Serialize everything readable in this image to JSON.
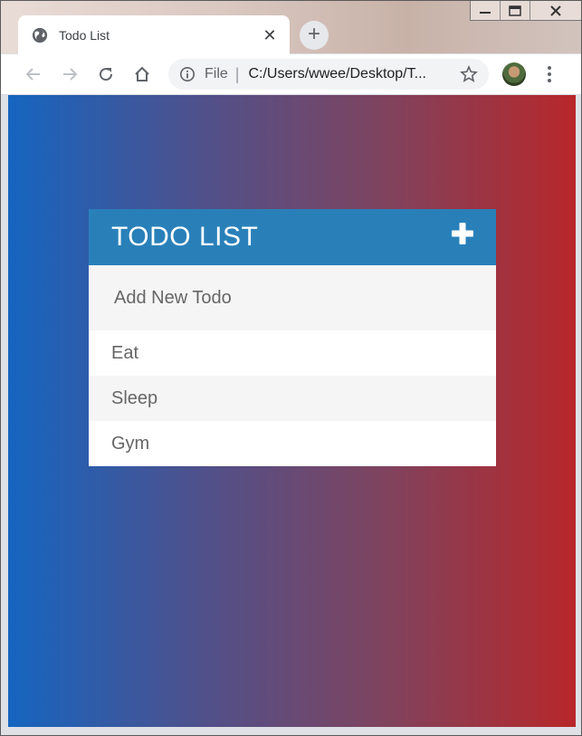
{
  "browser": {
    "tab_title": "Todo List",
    "tab_close": "✕",
    "new_tab": "+",
    "address_scheme": "File",
    "address_separator": "|",
    "address_url": "C:/Users/wwee/Desktop/T...",
    "window_controls": [
      "minimize",
      "maximize",
      "close"
    ]
  },
  "icons": {
    "tab_favicon": "globe-icon",
    "back": "arrow-left-icon",
    "forward": "arrow-right-icon",
    "reload": "reload-icon",
    "home": "home-icon",
    "site_info": "info-icon",
    "bookmark": "star-icon",
    "menu": "kebab-menu-icon",
    "add_todo": "plus-icon"
  },
  "app": {
    "title": "TODO LIST",
    "input_placeholder": "Add New Todo",
    "todos": [
      "Eat",
      "Sleep",
      "Gym"
    ]
  },
  "colors": {
    "header": "#2980b9",
    "gradient_start": "#1565c0",
    "gradient_end": "#b7272a"
  }
}
